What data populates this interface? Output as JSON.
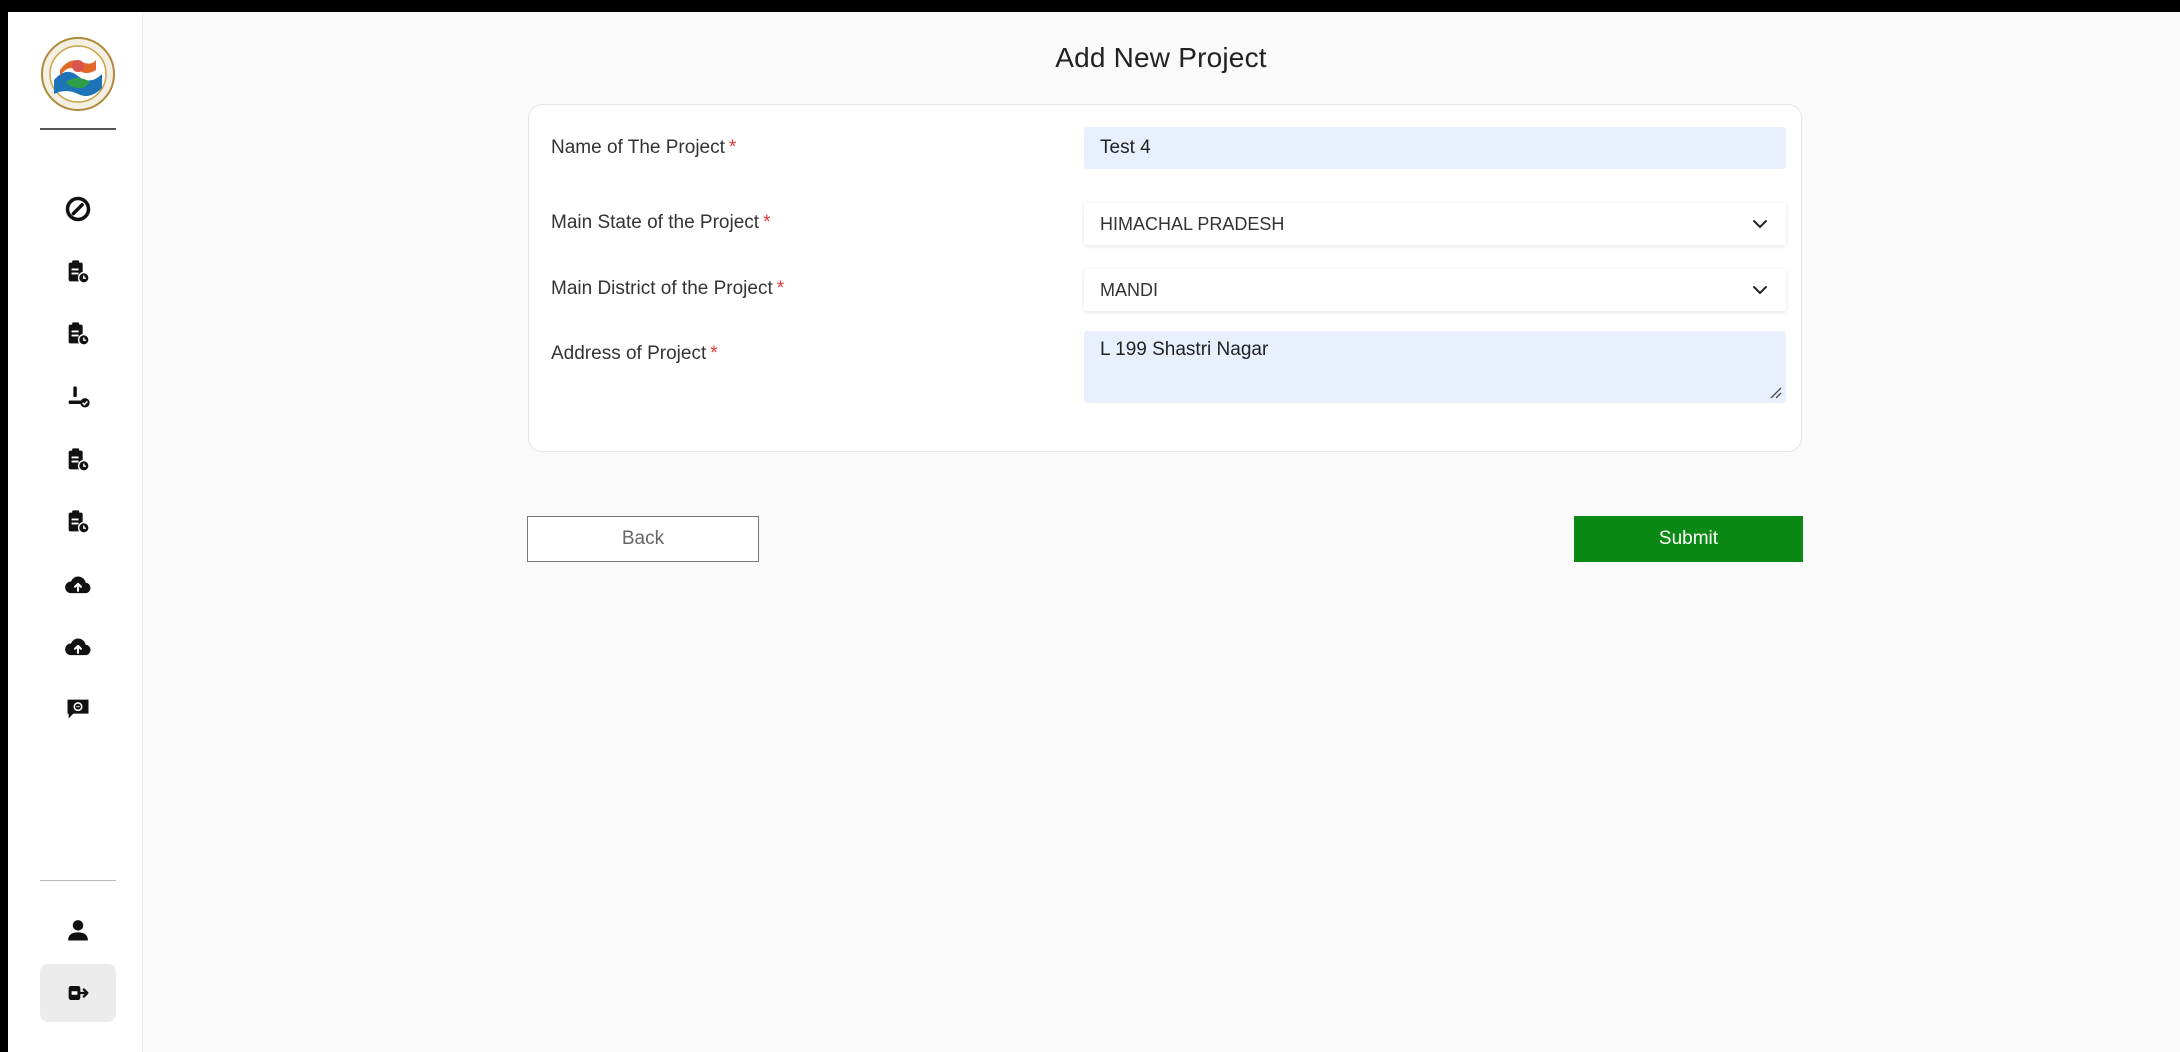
{
  "page": {
    "title": "Add New Project"
  },
  "sidebar": {
    "logo_icon": "emblem-logo",
    "items": [
      {
        "icon": "dashboard-gauge-icon"
      },
      {
        "icon": "clipboard-clock-icon"
      },
      {
        "icon": "clipboard-clock-icon"
      },
      {
        "icon": "user-check-icon"
      },
      {
        "icon": "clipboard-clock-icon"
      },
      {
        "icon": "clipboard-clock-icon"
      },
      {
        "icon": "cloud-upload-icon"
      },
      {
        "icon": "cloud-upload-icon"
      },
      {
        "icon": "feedback-message-icon"
      }
    ],
    "profile_icon": "user-icon",
    "logout_icon": "logout-icon"
  },
  "form": {
    "project_name": {
      "label": "Name of The Project",
      "required_mark": "*",
      "value": "Test 4"
    },
    "state": {
      "label": "Main State of the Project",
      "required_mark": "*",
      "value": "HIMACHAL PRADESH"
    },
    "district": {
      "label": "Main District of the Project",
      "required_mark": "*",
      "value": "MANDI"
    },
    "address": {
      "label": "Address of Project",
      "required_mark": "*",
      "value": "L 199 Shastri Nagar"
    }
  },
  "actions": {
    "back_label": "Back",
    "submit_label": "Submit"
  },
  "colors": {
    "submit_bg": "#0a8a14",
    "input_bg": "#e8f0fe",
    "required": "#e53935"
  }
}
